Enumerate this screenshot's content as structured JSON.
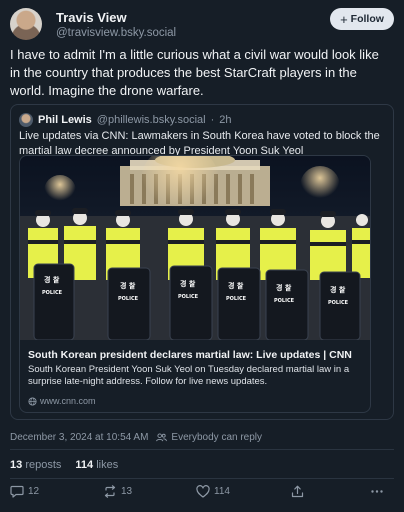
{
  "author": {
    "name": "Travis View",
    "handle": "@travisview.bsky.social",
    "follow_label": "Follow"
  },
  "post": {
    "text": "I have to admit I'm a little curious what a civil war would look like in the country that produces the best StarCraft players in the world. Imagine the drone warfare.",
    "timestamp": "December 3, 2024 at 10:54 AM",
    "reply_setting": "Everybody can reply"
  },
  "quote": {
    "author_name": "Phil Lewis",
    "author_handle": "@phillewis.bsky.social",
    "separator": "·",
    "age": "2h",
    "text": "Live updates via CNN: Lawmakers in South Korea have voted to block the martial law decree announced by President Yoon Suk Yeol",
    "link": {
      "title": "South Korean president declares martial law: Live updates | CNN",
      "description": "South Korean President Yoon Suk Yeol on Tuesday declared martial law in a surprise late-night address. Follow for live news updates.",
      "domain": "www.cnn.com",
      "image_texts": [
        "경 찰",
        "POLICE"
      ]
    }
  },
  "stats": {
    "reposts_count": "13",
    "reposts_label": "reposts",
    "likes_count": "114",
    "likes_label": "likes"
  },
  "actions": {
    "reply_count": "12",
    "repost_count": "13",
    "like_count": "114"
  },
  "colors": {
    "background": "#161e27",
    "text_primary": "#f1f3f5",
    "text_muted": "#8d98a5",
    "border": "#2e3845",
    "follow_button_bg": "#e2e7ee"
  }
}
